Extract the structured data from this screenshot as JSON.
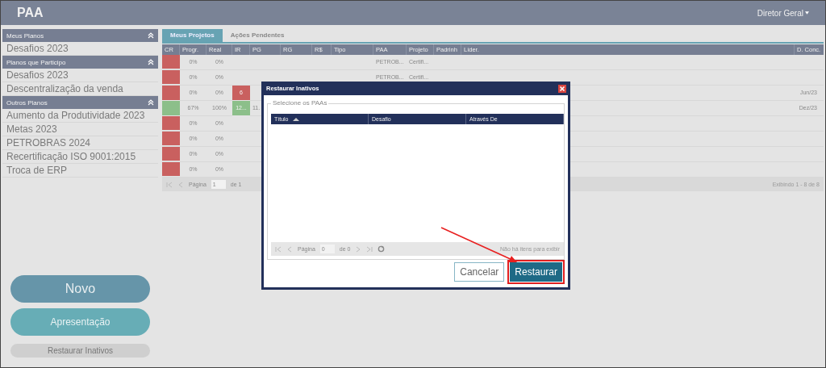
{
  "header": {
    "title": "PAA",
    "user": "Diretor Geral"
  },
  "sidebar": {
    "sections": [
      {
        "title": "Meus Planos",
        "expanded": true,
        "items": [
          "Desafios 2023"
        ]
      },
      {
        "title": "Planos que Participo",
        "expanded": true,
        "items": [
          "Desafios 2023",
          "Descentralização da venda"
        ]
      },
      {
        "title": "Outros Planos",
        "expanded": true,
        "items": [
          "Aumento da Produtividade 2023",
          "Metas 2023",
          "PETROBRAS 2024",
          "Recertificação ISO 9001:2015",
          "Troca de ERP"
        ]
      }
    ]
  },
  "actions": [
    {
      "label": "Novo",
      "kind": "primary"
    },
    {
      "label": "Apresentação",
      "kind": "secondary"
    },
    {
      "label": "Restaurar Inativos",
      "kind": "link"
    }
  ],
  "tabs": [
    {
      "label": "Meus Projetos",
      "selected": true
    },
    {
      "label": "Ações Pendentes",
      "selected": false
    }
  ],
  "table": {
    "columns": [
      "CR",
      "Progr.",
      "Real",
      "IR",
      "PG",
      "RG",
      "R$",
      "Tipo",
      "PAA",
      "Projeto",
      "Padrinh",
      "Líder.",
      "D. Conc."
    ],
    "rows": [
      {
        "cr": {
          "color": "#c9605f"
        },
        "progr": "0%",
        "real": "0%",
        "paa": "PETROB...",
        "projeto": "Certifi..."
      },
      {
        "cr": {
          "color": "#c9605f"
        },
        "progr": "0%",
        "real": "0%",
        "paa": "PETROB...",
        "projeto": "Certifi..."
      },
      {
        "cr": {
          "color": "#c9605f"
        },
        "progr": "0%",
        "real": "0%",
        "ir": {
          "text": "6",
          "color": "#c9605f"
        },
        "d_conc": "Jun/23"
      },
      {
        "cr": {
          "color": "#8cbf8a"
        },
        "progr": "67%",
        "real": "100%",
        "ir": {
          "text": "12...",
          "color": "#8cbf8a"
        },
        "pg": "11.",
        "d_conc": "Dez/23"
      },
      {
        "cr": {
          "color": "#c9605f"
        },
        "progr": "0%",
        "real": "0%"
      },
      {
        "cr": {
          "color": "#c9605f"
        },
        "progr": "0%",
        "real": "0%"
      },
      {
        "cr": {
          "color": "#c9605f"
        },
        "progr": "0%",
        "real": "0%"
      },
      {
        "cr": {
          "color": "#c9605f"
        },
        "progr": "0%",
        "real": "0%"
      }
    ],
    "pager": {
      "page_label": "Página",
      "page": "1",
      "of": "de 1",
      "summary": "Exibindo 1 - 8 de 8"
    }
  },
  "dialog": {
    "title": "Restaurar Inativos",
    "group_label": "Selecione os PAAs",
    "columns": [
      {
        "label": "Título",
        "sorted": true
      },
      {
        "label": "Desafio",
        "sorted": false
      },
      {
        "label": "Através De",
        "sorted": false
      }
    ],
    "pager": {
      "page_label": "Página",
      "page": "0",
      "of": "de 0",
      "empty": "Não há itens para exibir"
    },
    "buttons": [
      {
        "label": "Cancelar",
        "kind": "secondary",
        "highlighted": false
      },
      {
        "label": "Restaurar",
        "kind": "primary",
        "highlighted": true
      }
    ]
  }
}
